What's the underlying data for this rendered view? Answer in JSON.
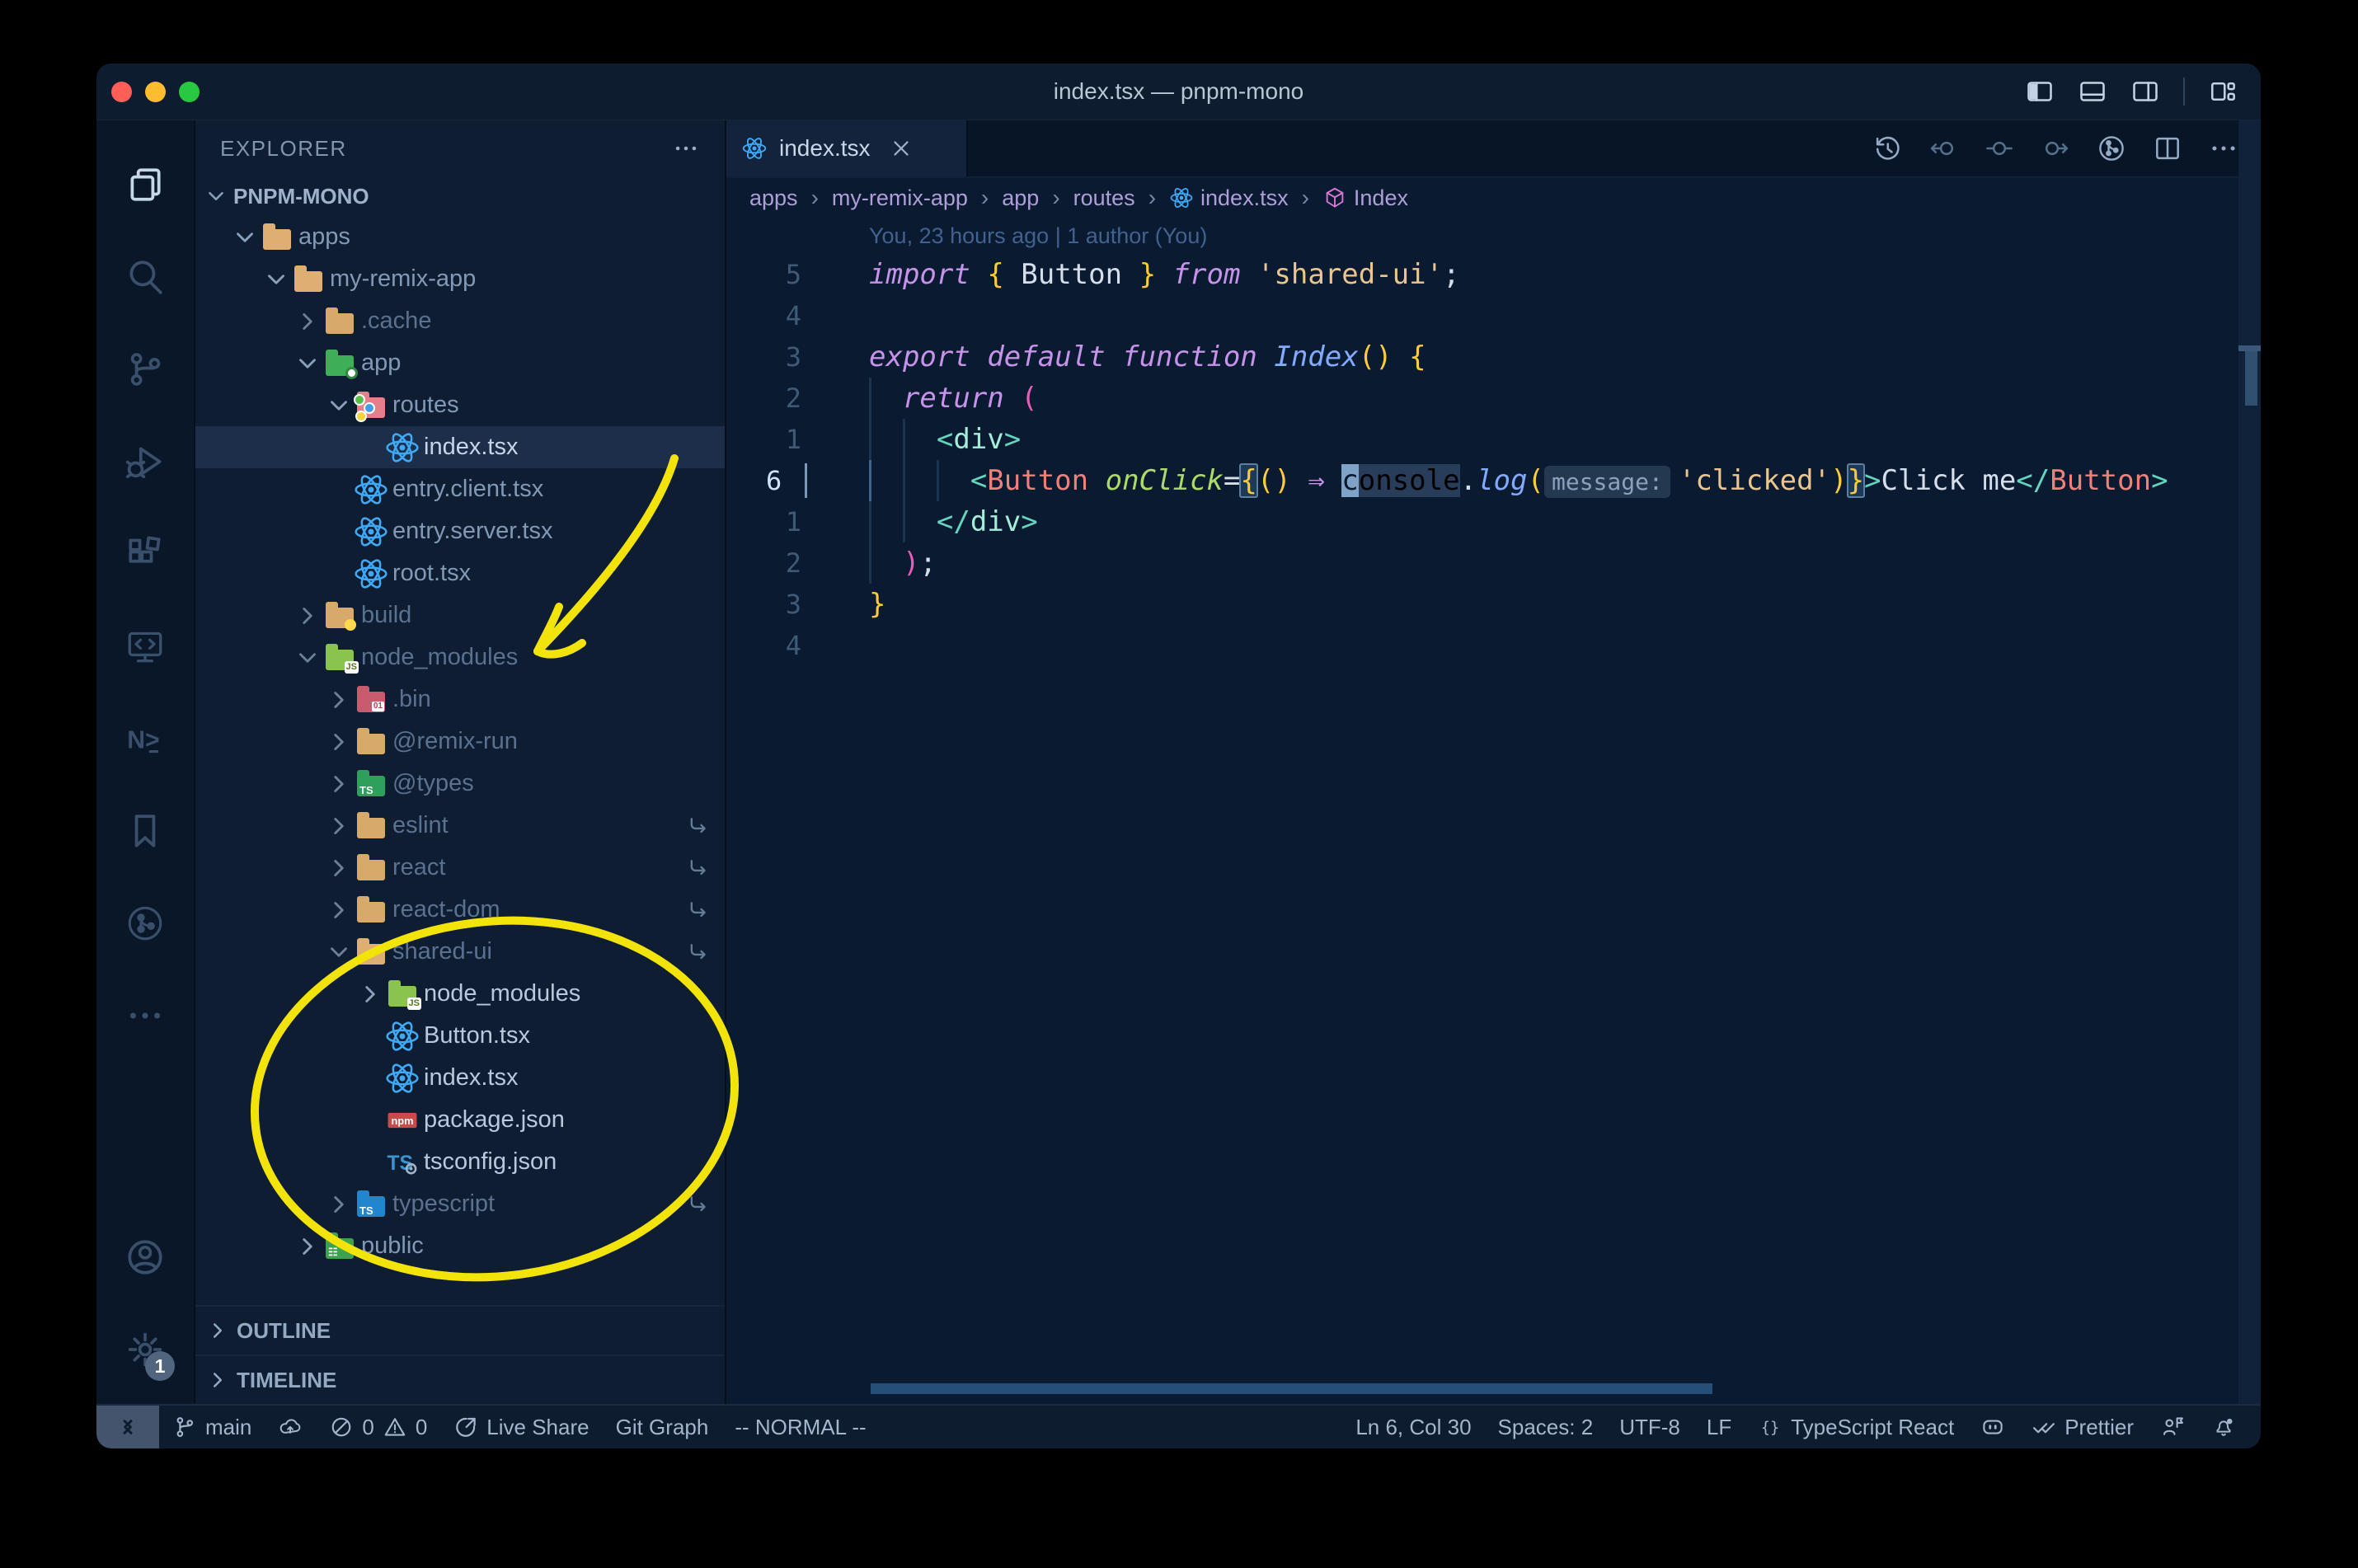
{
  "colors": {
    "annotation_yellow": "#f2e30a",
    "window_bg": "#0a1a30",
    "accent_blue": "#3fa9f5",
    "selection_row": "#1c2e49",
    "traffic": [
      "#ff5f57",
      "#febc2e",
      "#28c840"
    ]
  },
  "title_bar": {
    "title": "index.tsx — pnpm-mono",
    "controls": [
      "layout-sidebar-left",
      "layout-panel",
      "layout-sidebar-right"
    ],
    "customize": "layout-customize"
  },
  "activity_bar": {
    "top": [
      {
        "name": "explorer",
        "active": true
      },
      {
        "name": "search"
      },
      {
        "name": "source-control"
      },
      {
        "name": "run-debug"
      },
      {
        "name": "extensions"
      },
      {
        "name": "remote-explorer"
      },
      {
        "name": "nx-console"
      },
      {
        "name": "bookmarks"
      },
      {
        "name": "gitlens"
      },
      {
        "name": "more-views"
      }
    ],
    "bottom": [
      {
        "name": "accounts"
      },
      {
        "name": "settings",
        "badge": "1"
      }
    ]
  },
  "sidebar": {
    "title": "EXPLORER",
    "workspace": "PNPM-MONO",
    "tree": [
      {
        "label": "apps",
        "icon": "folder-open-tan",
        "level": 0,
        "chevron": "down"
      },
      {
        "label": "my-remix-app",
        "icon": "folder-open-tan",
        "level": 1,
        "chevron": "down"
      },
      {
        "label": ".cache",
        "icon": "folder-tan",
        "level": 2,
        "chevron": "right",
        "style": "dim"
      },
      {
        "label": "app",
        "icon": "folder-app",
        "level": 2,
        "chevron": "down"
      },
      {
        "label": "routes",
        "icon": "folder-routes",
        "level": 3,
        "chevron": "down"
      },
      {
        "label": "index.tsx",
        "icon": "react",
        "level": 4,
        "selected": true
      },
      {
        "label": "entry.client.tsx",
        "icon": "react",
        "level": 3
      },
      {
        "label": "entry.server.tsx",
        "icon": "react",
        "level": 3
      },
      {
        "label": "root.tsx",
        "icon": "react",
        "level": 3
      },
      {
        "label": "build",
        "icon": "folder-build",
        "level": 2,
        "chevron": "right",
        "style": "dim"
      },
      {
        "label": "node_modules",
        "icon": "folder-node",
        "level": 2,
        "chevron": "down",
        "style": "dim"
      },
      {
        "label": ".bin",
        "icon": "folder-bin",
        "level": 3,
        "chevron": "right",
        "style": "dim"
      },
      {
        "label": "@remix-run",
        "icon": "folder-tan",
        "level": 3,
        "chevron": "right",
        "style": "dim"
      },
      {
        "label": "@types",
        "icon": "folder-types",
        "level": 3,
        "chevron": "right",
        "style": "dim"
      },
      {
        "label": "eslint",
        "icon": "folder-tan",
        "level": 3,
        "chevron": "right",
        "style": "dim",
        "symlink": true
      },
      {
        "label": "react",
        "icon": "folder-tan",
        "level": 3,
        "chevron": "right",
        "style": "dim",
        "symlink": true
      },
      {
        "label": "react-dom",
        "icon": "folder-tan",
        "level": 3,
        "chevron": "right",
        "style": "dim",
        "symlink": true
      },
      {
        "label": "shared-ui",
        "icon": "folder-open-tan",
        "level": 3,
        "chevron": "down",
        "style": "dim",
        "symlink": true
      },
      {
        "label": "node_modules",
        "icon": "folder-node",
        "level": 4,
        "chevron": "right",
        "style": "bright"
      },
      {
        "label": "Button.tsx",
        "icon": "react",
        "level": 4,
        "style": "bright"
      },
      {
        "label": "index.tsx",
        "icon": "react",
        "level": 4,
        "style": "bright"
      },
      {
        "label": "package.json",
        "icon": "npm",
        "level": 4,
        "style": "bright"
      },
      {
        "label": "tsconfig.json",
        "icon": "tsconfig",
        "level": 4,
        "style": "bright"
      },
      {
        "label": "typescript",
        "icon": "folder-ts",
        "level": 3,
        "chevron": "right",
        "style": "dim",
        "symlink": true
      },
      {
        "label": "public",
        "icon": "folder-public",
        "level": 2,
        "chevron": "right"
      }
    ],
    "panels": [
      {
        "label": "OUTLINE"
      },
      {
        "label": "TIMELINE"
      }
    ]
  },
  "editor": {
    "tab": {
      "label": "index.tsx",
      "icon": "react"
    },
    "toolbar": [
      {
        "name": "history",
        "dim": false
      },
      {
        "name": "nav-back",
        "dim": true
      },
      {
        "name": "nav-dot",
        "dim": true
      },
      {
        "name": "nav-forward",
        "dim": true
      },
      {
        "name": "gitlens-graph",
        "dim": false
      },
      {
        "name": "split-editor",
        "dim": false
      },
      {
        "name": "more-actions",
        "dim": false
      }
    ],
    "breadcrumbs": [
      {
        "label": "apps"
      },
      {
        "label": "my-remix-app"
      },
      {
        "label": "app"
      },
      {
        "label": "routes"
      },
      {
        "label": "index.tsx",
        "icon": "react"
      },
      {
        "label": "Index",
        "icon": "symbol-cube"
      }
    ],
    "blame": "You, 23 hours ago | 1 author (You)",
    "lines": [
      {
        "num": "5",
        "tokens": [
          [
            "import",
            "kw"
          ],
          [
            " ",
            "tx"
          ],
          [
            "{",
            "y"
          ],
          [
            " Button ",
            "tx"
          ],
          [
            "}",
            "y"
          ],
          [
            " ",
            "tx"
          ],
          [
            "from",
            "kw"
          ],
          [
            " ",
            "tx"
          ],
          [
            "'shared-ui'",
            "str"
          ],
          [
            ";",
            "tx"
          ]
        ]
      },
      {
        "num": "4",
        "tokens": []
      },
      {
        "num": "3",
        "tokens": [
          [
            "export",
            "kw"
          ],
          [
            " ",
            "tx"
          ],
          [
            "default",
            "kw"
          ],
          [
            " ",
            "tx"
          ],
          [
            "function",
            "kw"
          ],
          [
            " ",
            "tx"
          ],
          [
            "Index",
            "fnb"
          ],
          [
            "()",
            "y"
          ],
          [
            " ",
            "tx"
          ],
          [
            "{",
            "y"
          ]
        ]
      },
      {
        "num": "2",
        "tokens": [
          [
            "  ",
            "g"
          ],
          [
            "return",
            "kw"
          ],
          [
            " ",
            "tx"
          ],
          [
            "(",
            "pk"
          ]
        ]
      },
      {
        "num": "1",
        "tokens": [
          [
            "  ",
            "g"
          ],
          [
            "  ",
            "g"
          ],
          [
            "<",
            "tag"
          ],
          [
            "div",
            "tagn"
          ],
          [
            ">",
            "tag"
          ]
        ]
      },
      {
        "num": "6",
        "current": true,
        "tokens": [
          [
            "  ",
            "gb"
          ],
          [
            "  ",
            "g"
          ],
          [
            "  ",
            "g"
          ],
          [
            "<",
            "tag"
          ],
          [
            "Button",
            "cmp"
          ],
          [
            " ",
            "tx"
          ],
          [
            "onClick",
            "attr"
          ],
          [
            "=",
            "tx"
          ],
          [
            "{",
            "ybox"
          ],
          [
            "()",
            "y"
          ],
          [
            " ",
            "tx"
          ],
          [
            "⇒",
            "kw"
          ],
          [
            " ",
            "tx"
          ],
          [
            "c",
            "cursor"
          ],
          [
            "onsole",
            "hl"
          ],
          [
            ".",
            "tx"
          ],
          [
            "log",
            "fnb"
          ],
          [
            "(",
            "y"
          ],
          [
            "message:",
            "inlay"
          ],
          [
            "'clicked'",
            "str"
          ],
          [
            ")",
            "y"
          ],
          [
            "}",
            "ybox"
          ],
          [
            ">",
            "tag"
          ],
          [
            "Click me",
            "tx"
          ],
          [
            "</",
            "tag"
          ],
          [
            "Button",
            "cmp"
          ],
          [
            ">",
            "tag"
          ]
        ]
      },
      {
        "num": "1",
        "tokens": [
          [
            "  ",
            "g"
          ],
          [
            "  ",
            "g"
          ],
          [
            "</",
            "tag"
          ],
          [
            "div",
            "tagn"
          ],
          [
            ">",
            "tag"
          ]
        ]
      },
      {
        "num": "2",
        "tokens": [
          [
            "  ",
            "g"
          ],
          [
            ")",
            "pk"
          ],
          [
            ";",
            "tx"
          ]
        ]
      },
      {
        "num": "3",
        "tokens": [
          [
            "}",
            "y"
          ]
        ]
      },
      {
        "num": "4",
        "tokens": []
      }
    ]
  },
  "status_bar": {
    "left": [
      {
        "name": "remote",
        "icon": "remote-indicator"
      },
      {
        "name": "git-branch",
        "icon": "branch",
        "label": "main"
      },
      {
        "name": "publish",
        "icon": "cloud-upload"
      },
      {
        "name": "problems",
        "errors": "0",
        "warnings": "0"
      },
      {
        "name": "live-share",
        "icon": "live-share",
        "label": "Live Share"
      },
      {
        "name": "git-graph",
        "label": "Git Graph"
      },
      {
        "name": "vim-mode",
        "label": "-- NORMAL --"
      }
    ],
    "right": [
      {
        "name": "cursor-position",
        "label": "Ln 6, Col 30"
      },
      {
        "name": "indentation",
        "label": "Spaces: 2"
      },
      {
        "name": "encoding",
        "label": "UTF-8"
      },
      {
        "name": "eol",
        "label": "LF"
      },
      {
        "name": "language-mode",
        "icon": "braces",
        "label": "TypeScript React"
      },
      {
        "name": "copilot",
        "icon": "copilot"
      },
      {
        "name": "formatter",
        "icon": "double-check",
        "label": "Prettier"
      },
      {
        "name": "feedback",
        "icon": "feedback"
      },
      {
        "name": "notifications",
        "icon": "bell-dot"
      }
    ]
  }
}
